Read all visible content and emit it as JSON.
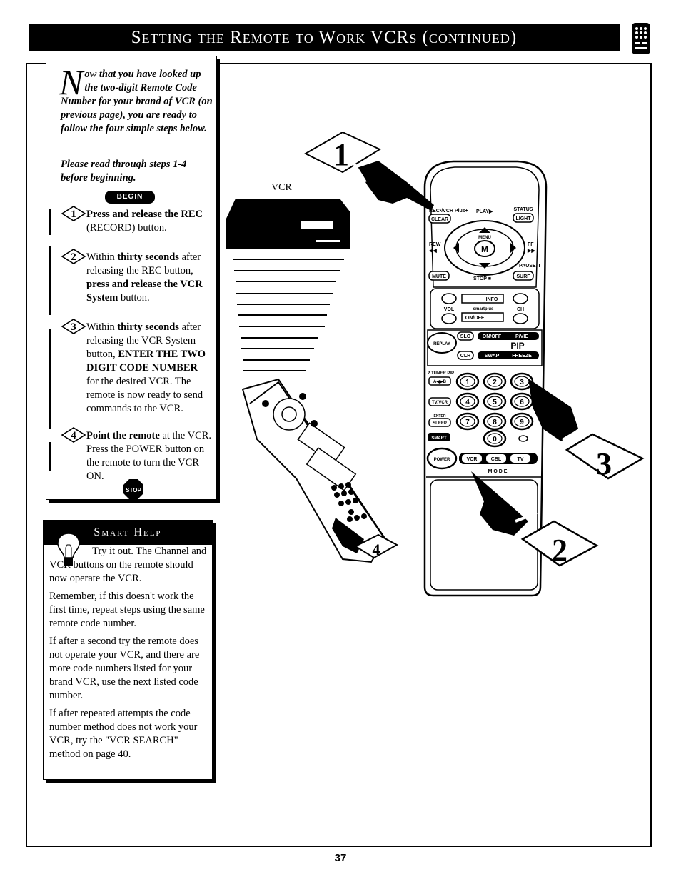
{
  "header": {
    "title": "Setting the Remote to Work VCRs (continued)",
    "tab_icon": "remote-control-icon"
  },
  "intro": {
    "drop_cap": "N",
    "text": "ow that you have looked up the two-digit Remote Code Number for your brand of VCR (on previous page), you are ready to follow the four simple steps below.",
    "please": "Please read through steps 1-4 before beginning.",
    "begin_label": "BEGIN"
  },
  "steps": [
    {
      "number": "1",
      "parts": [
        {
          "b": true,
          "t": "Press and release the REC "
        },
        {
          "b": false,
          "t": "(RECORD) button."
        }
      ]
    },
    {
      "number": "2",
      "parts": [
        {
          "b": false,
          "t": "Within "
        },
        {
          "b": true,
          "t": "thirty seconds"
        },
        {
          "b": false,
          "t": " after releasing the REC button, "
        },
        {
          "b": true,
          "t": "press and release the VCR System"
        },
        {
          "b": false,
          "t": " button."
        }
      ]
    },
    {
      "number": "3",
      "parts": [
        {
          "b": false,
          "t": "Within "
        },
        {
          "b": true,
          "t": "thirty seconds"
        },
        {
          "b": false,
          "t": " after releasing the VCR System button, "
        },
        {
          "b": true,
          "t": "ENTER THE TWO DIGIT CODE NUMBER"
        },
        {
          "b": false,
          "t": " for the desired VCR. The remote is now ready to send commands to the VCR."
        }
      ]
    },
    {
      "number": "4",
      "parts": [
        {
          "b": true,
          "t": "Point the remote"
        },
        {
          "b": false,
          "t": " at the VCR. Press the POWER button on the remote to turn the VCR ON."
        }
      ]
    }
  ],
  "stop_label": "STOP",
  "smart_help": {
    "title": "Smart Help",
    "paragraphs": [
      "Try it out. The Channel and VCR buttons on the remote should now operate the VCR.",
      "Remember, if this doesn't work the first time, repeat steps using the same remote code number.",
      "If after a second try the remote does not operate your VCR, and there are more code numbers listed for your brand VCR, use the next listed code number.",
      "If after repeated attempts the code number method does not work your VCR, try the \"VCR SEARCH\" method on page 40."
    ]
  },
  "illustration": {
    "vcr_label": "VCR",
    "callouts": [
      "1",
      "2",
      "3",
      "4"
    ],
    "remote": {
      "top_labels": {
        "rec": "REC•/VCR Plus+",
        "clear": "CLEAR",
        "play": "PLAY▶",
        "status": "STATUS",
        "light": "LIGHT",
        "menu": "MENU",
        "m": "M",
        "rew": "REW",
        "rew_sym": "◀◀",
        "ff": "FF",
        "ff_sym": "▶▶",
        "pause": "PAUSE II",
        "mute": "MUTE",
        "stop": "STOP ■",
        "surf": "SURF"
      },
      "mid_labels": {
        "vol": "VOL",
        "ch": "CH",
        "info": "INFO",
        "brand": "smartplus",
        "onoff": "ON/OFF"
      },
      "pip_labels": {
        "replay": "REPLAY",
        "slo": "SLO",
        "clr": "CLR",
        "pip_onoff": "ON/OFF",
        "pvie": "P/VIE",
        "pip": "PIP",
        "swap": "SWAP",
        "freeze": "FREEZE"
      },
      "side_labels": {
        "tuner": "2 TUNER PIP",
        "ab": "A◀▶B",
        "tvvcr": "TV/VCR",
        "enter": "ENTER",
        "sleep": "SLEEP",
        "smart": "SMART",
        "power": "POWER"
      },
      "digits": [
        "1",
        "2",
        "3",
        "4",
        "5",
        "6",
        "7",
        "8",
        "9",
        "0"
      ],
      "mode_buttons": [
        "VCR",
        "CBL",
        "TV"
      ],
      "mode_label": "M O D E"
    }
  },
  "page_number": "37"
}
